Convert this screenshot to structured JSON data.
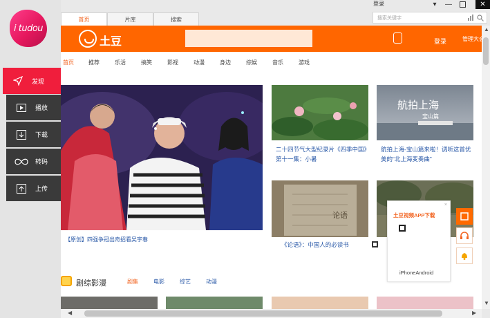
{
  "window": {
    "login": "登录",
    "search_placeholder": "搜索关键字"
  },
  "tabs": [
    {
      "label": "首页",
      "active": true
    },
    {
      "label": "片库",
      "active": false
    },
    {
      "label": "搜索",
      "active": false
    }
  ],
  "sidebar": {
    "logo_text": "i tudou",
    "items": [
      {
        "label": "发现",
        "icon": "send-icon",
        "active": true
      },
      {
        "label": "播放",
        "icon": "play-icon",
        "active": false
      },
      {
        "label": "下载",
        "icon": "download-icon",
        "active": false
      },
      {
        "label": "转码",
        "icon": "infinity-icon",
        "active": false
      },
      {
        "label": "上传",
        "icon": "upload-icon",
        "active": false
      }
    ]
  },
  "site": {
    "name": "土豆",
    "login": "登录",
    "admin": "管理大会",
    "brand_color": "#ff6600"
  },
  "nav": [
    "首页",
    "推荐",
    "乐活",
    "搞笑",
    "影视",
    "动漫",
    "身边",
    "综娱",
    "音乐",
    "游戏"
  ],
  "hero": {
    "caption": "【原创】四强争冠出奇招看吴宇春"
  },
  "cards": [
    {
      "title": "二十四节气大型纪录片《四季中国》第十一集：小暑"
    },
    {
      "title": "航拍上海-宝山篇来啦！调听这首优美的“北上海变奏曲”",
      "overlay_title": "航拍上海",
      "overlay_sub": "宝山篇"
    },
    {
      "title": "《论语》：中国人的必读书",
      "overlay_title": "论语"
    },
    {
      "title": ""
    }
  ],
  "section": {
    "title": "剧综影漫",
    "tabs": [
      "剧集",
      "电影",
      "综艺",
      "动漫"
    ]
  },
  "qr_popup": {
    "title": "土豆视频APP下载",
    "footer": "iPhoneAndroid"
  }
}
